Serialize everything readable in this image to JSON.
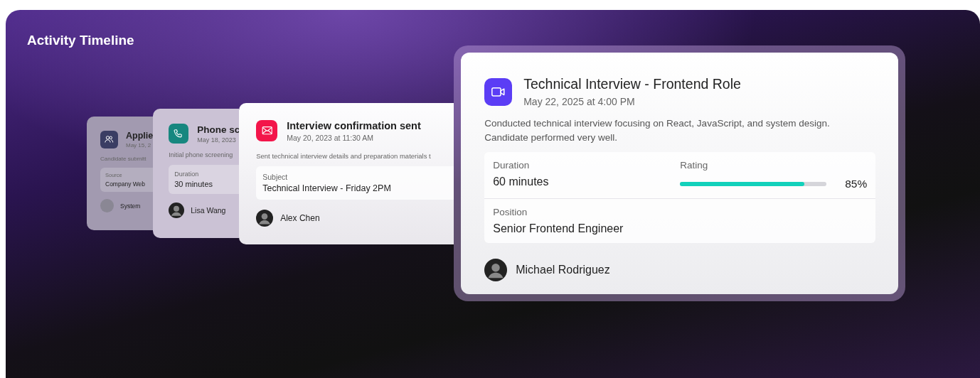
{
  "title": "Activity Timeline",
  "events": [
    {
      "color": "#3a3d63",
      "title": "Applie",
      "date": "May 15, 2",
      "description": "Candidate submitt",
      "details": [
        [
          {
            "kind": "text",
            "label": "Source",
            "value": "Company Web"
          }
        ]
      ],
      "person": {
        "name": "System"
      }
    },
    {
      "color": "#17877f",
      "title": "Phone sc",
      "date": "May 18, 2023",
      "description": "Initial phone screening",
      "details": [
        [
          {
            "kind": "text",
            "label": "Duration",
            "value": "30 minutes"
          }
        ]
      ],
      "person": {
        "name": "Lisa Wang"
      }
    },
    {
      "color": "#f3154a",
      "title": "Interview confirmation sent",
      "date": "May 20, 2023 at 11:30 AM",
      "description": "Sent technical interview details and preparation materials t",
      "details": [
        [
          {
            "kind": "text",
            "label": "Subject",
            "value": "Technical Interview - Friday 2PM"
          }
        ]
      ],
      "person": {
        "name": "Alex Chen"
      }
    },
    {
      "color": "#5b3df5",
      "title": "Technical Interview - Frontend Role",
      "date": "May 22, 2025 at 4:00 PM",
      "description": "Conducted technical interview focusing on React, JavaScript, and system design. Candidate performed very well.",
      "details": [
        [
          {
            "kind": "text",
            "label": "Duration",
            "value": "60 minutes"
          },
          {
            "kind": "meter",
            "label": "Rating",
            "level": 0.85,
            "reading": "85%"
          }
        ],
        [
          {
            "kind": "text",
            "label": "Position",
            "value": "Senior Frontend Engineer"
          }
        ]
      ],
      "person": {
        "name": "Michael Rodriguez"
      }
    }
  ]
}
